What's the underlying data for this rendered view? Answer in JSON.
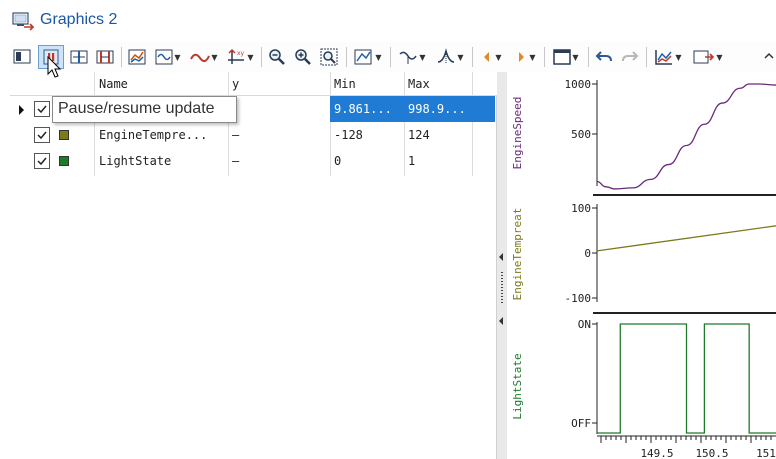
{
  "window": {
    "title": "Graphics 2"
  },
  "tooltip": {
    "text": "Pause/resume update"
  },
  "toolbar": {
    "buttons": [
      "fit-view-button",
      "pause-resume-button",
      "cursor-button",
      "difference-cursor-button",
      "chart-type-button",
      "signal-style-button",
      "line-style-button",
      "axis-button",
      "zoom-out-button",
      "zoom-in-button",
      "zoom-fit-button",
      "measure-button",
      "curve-button",
      "peak-button",
      "scroll-left-button",
      "scroll-right-button",
      "layout-button",
      "undo-button",
      "redo-button",
      "options-button",
      "export-button"
    ]
  },
  "grid": {
    "columns": [
      "Name",
      "y",
      "Min",
      "Max"
    ],
    "rows": [
      {
        "name": "",
        "y": "",
        "min": "9.861...",
        "max": "998.9...",
        "color": "#7a3a8a",
        "checked": true,
        "selected": true
      },
      {
        "name": "EngineTempre...",
        "y": "–",
        "min": "-128",
        "max": "124",
        "color": "#7b7b1e",
        "checked": true,
        "selected": false
      },
      {
        "name": "LightState",
        "y": "–",
        "min": "0",
        "max": "1",
        "color": "#1e7b2a",
        "checked": true,
        "selected": false
      }
    ]
  },
  "colors": {
    "engine_speed": "#6a2a7a",
    "engine_temp": "#7b7b1e",
    "light_state": "#1e7b2a",
    "selection": "#1f7bd3"
  },
  "chart_data": [
    {
      "type": "line",
      "title": "",
      "ylabel": "EngineSpeed",
      "yticks": [
        "1000",
        "500"
      ],
      "ylim": [
        0,
        1000
      ],
      "series": [
        {
          "x": [
            0,
            0.05,
            0.1,
            0.2,
            0.3,
            0.4,
            0.5,
            0.6,
            0.7,
            0.8,
            0.85,
            0.9,
            1.0
          ],
          "values": [
            80,
            30,
            10,
            20,
            100,
            240,
            420,
            620,
            820,
            960,
            1000,
            1000,
            990
          ]
        }
      ]
    },
    {
      "type": "line",
      "title": "",
      "ylabel": "EngineTempreat",
      "yticks": [
        "100",
        "0",
        "-100"
      ],
      "ylim": [
        -128,
        124
      ],
      "series": [
        {
          "x": [
            0,
            1
          ],
          "values": [
            18,
            80
          ]
        }
      ]
    },
    {
      "type": "line",
      "title": "",
      "ylabel": "LightState",
      "yticks": [
        "ON",
        "OFF"
      ],
      "ylim": [
        0,
        1
      ],
      "series": [
        {
          "x": [
            0,
            0.13,
            0.13,
            0.5,
            0.5,
            0.6,
            0.6,
            0.85,
            0.85,
            1.0
          ],
          "values": [
            0,
            0,
            1,
            1,
            0,
            0,
            1,
            1,
            0,
            0
          ]
        }
      ],
      "xticks": [
        "149.5",
        "150.5",
        "151"
      ]
    }
  ]
}
